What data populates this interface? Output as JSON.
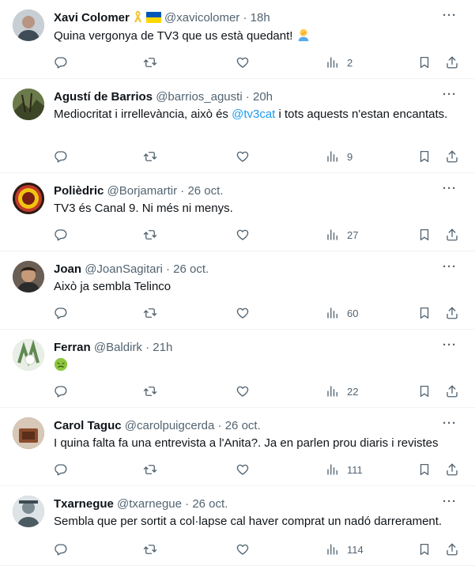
{
  "replies": [
    {
      "name": "Xavi Colomer",
      "handle": "@xavicolomer",
      "time": "18h",
      "text": "Quina vergonya de TV3 que us està quedant!",
      "text_after": "",
      "mention": "",
      "views": "2",
      "badges": [
        "ribbon",
        "ukraine-flag"
      ],
      "trailing_emoji": "facepalm",
      "avatar_color": "#8a9aa6"
    },
    {
      "name": "Agustí de Barrios",
      "handle": "@barrios_agusti",
      "time": "20h",
      "text": "Mediocritat i irrellevància, això és ",
      "mention": "@tv3cat",
      "text_after": " i tots aquests n'estan encantats.",
      "views": "9",
      "badges": [],
      "trailing_emoji": "",
      "avatar_color": "#5c6b3f"
    },
    {
      "name": "Polièdric",
      "handle": "@Borjamartir",
      "time": "26 oct.",
      "text": "TV3 és Canal 9. Ni més ni menys.",
      "mention": "",
      "text_after": "",
      "views": "27",
      "badges": [],
      "trailing_emoji": "",
      "avatar_color": "#b8312a"
    },
    {
      "name": "Joan",
      "handle": "@JoanSagitari",
      "time": "26 oct.",
      "text": "Això ja sembla Telinco",
      "mention": "",
      "text_after": "",
      "views": "60",
      "badges": [],
      "trailing_emoji": "",
      "avatar_color": "#4a3a30"
    },
    {
      "name": "Ferran",
      "handle": "@Baldirk",
      "time": "21h",
      "text": "",
      "mention": "",
      "text_after": "",
      "views": "22",
      "badges": [],
      "trailing_emoji": "nauseated-face",
      "avatar_color": "#9fb79a"
    },
    {
      "name": "Carol Taguc",
      "handle": "@carolpuigcerda",
      "time": "26 oct.",
      "text": "I quina falta  fa una entrevista a l'Anita?. Ja en parlen prou diaris i revistes",
      "mention": "",
      "text_after": "",
      "views": "111",
      "badges": [],
      "trailing_emoji": "",
      "avatar_color": "#7a4a32"
    },
    {
      "name": "Txarnegue",
      "handle": "@txarnegue",
      "time": "26 oct.",
      "text": "Sembla que per sortit a col·lapse cal haver comprat un nadó darrerament.",
      "mention": "",
      "text_after": "",
      "views": "114",
      "badges": [],
      "trailing_emoji": "",
      "avatar_color": "#5d6c74"
    }
  ],
  "icons": {
    "reply": "reply-icon",
    "retweet": "retweet-icon",
    "like": "like-icon",
    "views": "views-icon",
    "bookmark": "bookmark-icon",
    "share": "share-icon",
    "more": "more-icon"
  },
  "colors": {
    "name": "#0f1419",
    "secondary": "#536471",
    "link": "#1d9bf0",
    "divider": "#eff3f4"
  }
}
